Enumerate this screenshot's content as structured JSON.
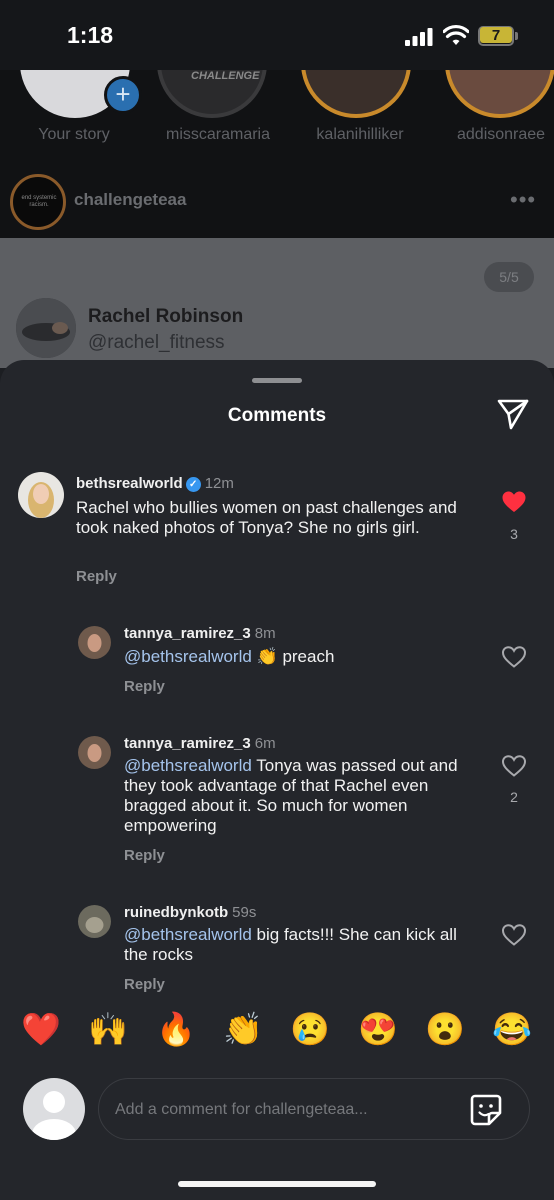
{
  "status_bar": {
    "time": "1:18",
    "battery": "7"
  },
  "stories": [
    {
      "label": "Your story",
      "icon": "plus-icon"
    },
    {
      "label": "misscaramaria"
    },
    {
      "label": "kalanihilliker"
    },
    {
      "label": "addisonraee"
    }
  ],
  "post": {
    "username": "challengeteaa",
    "avatar_text": "end systemic racism.",
    "more_icon": "ellipsis-icon",
    "counter": "5/5",
    "quoted_name": "Rachel Robinson",
    "quoted_handle": "@rachel_fitness"
  },
  "sheet": {
    "title": "Comments",
    "share_icon": "send-icon"
  },
  "comments": [
    {
      "username": "bethsrealworld",
      "verified": true,
      "ago": "12m",
      "text": "Rachel who bullies women on past challenges and took naked photos of Tonya?  She no girls girl.",
      "reply": "Reply",
      "likes": "3",
      "liked": true
    },
    {
      "username": "tannya_ramirez_3",
      "ago": "8m",
      "mention": "@bethsrealworld",
      "text": " 👏 preach",
      "reply": "Reply",
      "likes": ""
    },
    {
      "username": "tannya_ramirez_3",
      "ago": "6m",
      "mention": "@bethsrealworld",
      "text": " Tonya was passed out and they took advantage  of that Rachel even bragged about it. So much for women empowering",
      "reply": "Reply",
      "likes": "2"
    },
    {
      "username": "ruinedbynkotb",
      "ago": "59s",
      "mention": "@bethsrealworld",
      "text": " big facts!!! She can kick all the rocks",
      "reply": "Reply",
      "likes": ""
    }
  ],
  "emoji_reactions": [
    "❤️",
    "🙌",
    "🔥",
    "👏",
    "😢",
    "😍",
    "😮",
    "😂"
  ],
  "composer": {
    "placeholder": "Add a comment for challengeteaa...",
    "sticker_icon": "sticker-icon"
  },
  "colors": {
    "sheet_bg": "#24262b",
    "like_red": "#ff3040",
    "mention_blue": "#a5c4ec",
    "verified_blue": "#3797f0"
  }
}
